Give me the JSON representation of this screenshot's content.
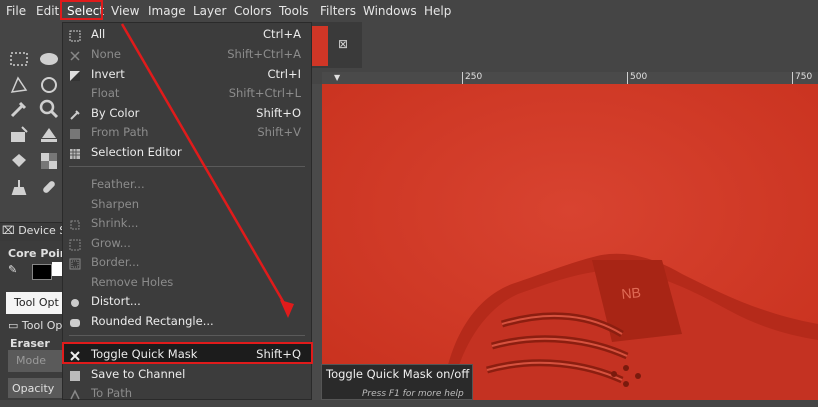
{
  "menubar": {
    "items": [
      "File",
      "Edit",
      "Select",
      "View",
      "Image",
      "Layer",
      "Colors",
      "Tools",
      "Filters",
      "Windows",
      "Help"
    ],
    "selected": "Select"
  },
  "select_menu": {
    "items": [
      {
        "label": "All",
        "shortcut": "Ctrl+A",
        "enabled": true,
        "icon": "select-all-icon"
      },
      {
        "label": "None",
        "shortcut": "Shift+Ctrl+A",
        "enabled": false,
        "icon": "select-none-icon"
      },
      {
        "label": "Invert",
        "shortcut": "Ctrl+I",
        "enabled": true,
        "icon": "invert-icon"
      },
      {
        "label": "Float",
        "shortcut": "Shift+Ctrl+L",
        "enabled": false,
        "icon": "float-icon"
      },
      {
        "label": "By Color",
        "shortcut": "Shift+O",
        "enabled": true,
        "icon": "by-color-icon"
      },
      {
        "label": "From Path",
        "shortcut": "Shift+V",
        "enabled": false,
        "icon": "from-path-icon"
      },
      {
        "label": "Selection Editor",
        "shortcut": "",
        "enabled": true,
        "icon": "selection-editor-icon"
      },
      {
        "label": "Feather...",
        "shortcut": "",
        "enabled": false,
        "icon": ""
      },
      {
        "label": "Sharpen",
        "shortcut": "",
        "enabled": false,
        "icon": ""
      },
      {
        "label": "Shrink...",
        "shortcut": "",
        "enabled": false,
        "icon": "shrink-icon"
      },
      {
        "label": "Grow...",
        "shortcut": "",
        "enabled": false,
        "icon": "grow-icon"
      },
      {
        "label": "Border...",
        "shortcut": "",
        "enabled": false,
        "icon": "border-icon"
      },
      {
        "label": "Remove Holes",
        "shortcut": "",
        "enabled": false,
        "icon": ""
      },
      {
        "label": "Distort...",
        "shortcut": "",
        "enabled": true,
        "icon": "distort-icon"
      },
      {
        "label": "Rounded Rectangle...",
        "shortcut": "",
        "enabled": true,
        "icon": "rounded-rect-icon"
      },
      {
        "label": "Toggle Quick Mask",
        "shortcut": "Shift+Q",
        "enabled": true,
        "icon": "quick-mask-icon",
        "highlighted": true
      },
      {
        "label": "Save to Channel",
        "shortcut": "",
        "enabled": true,
        "icon": "save-channel-icon"
      },
      {
        "label": "To Path",
        "shortcut": "",
        "enabled": false,
        "icon": "to-path-icon"
      }
    ]
  },
  "tooltip": {
    "title": "Toggle Quick Mask on/off",
    "help": "Press F1 for more help"
  },
  "ruler": {
    "labels": [
      "250",
      "500",
      "750"
    ]
  },
  "dock": {
    "device_status": "Device St",
    "core_pointer": "Core Poin",
    "tool_options_tab": "Tool Opt",
    "tool_options": "Tool Op",
    "eraser": "Eraser",
    "mode_label": "Mode",
    "opacity_label": "Opacity"
  },
  "colors": {
    "annotation": "#e01b1b",
    "canvas": "#d23a26",
    "menu_bg": "#3c3c3c"
  }
}
